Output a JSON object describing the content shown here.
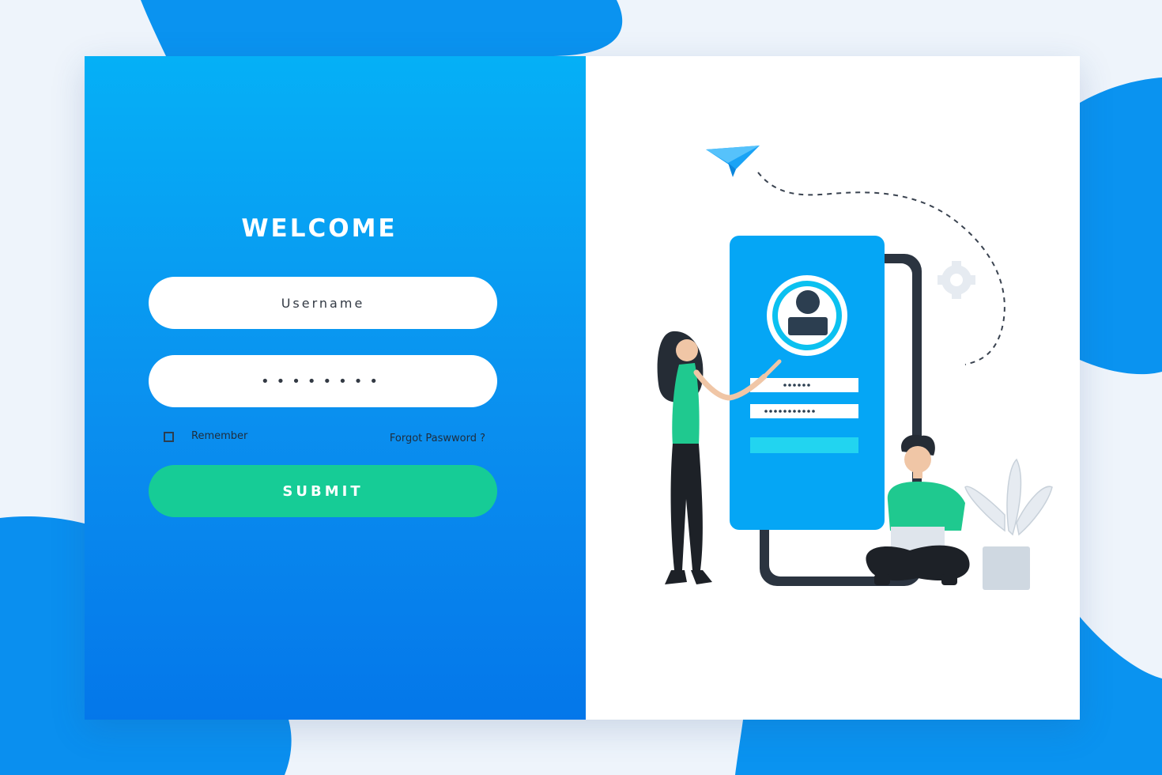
{
  "login": {
    "title": "WELCOME",
    "username_placeholder": "Username",
    "password_mask": "••••••••",
    "remember_label": "Remember",
    "forgot_label": "Forgot Paswword ?",
    "submit_label": "SUBMIT"
  },
  "colors": {
    "primary_blue": "#0a8fef",
    "accent_green": "#16cc96",
    "dark": "#2c3e50"
  }
}
